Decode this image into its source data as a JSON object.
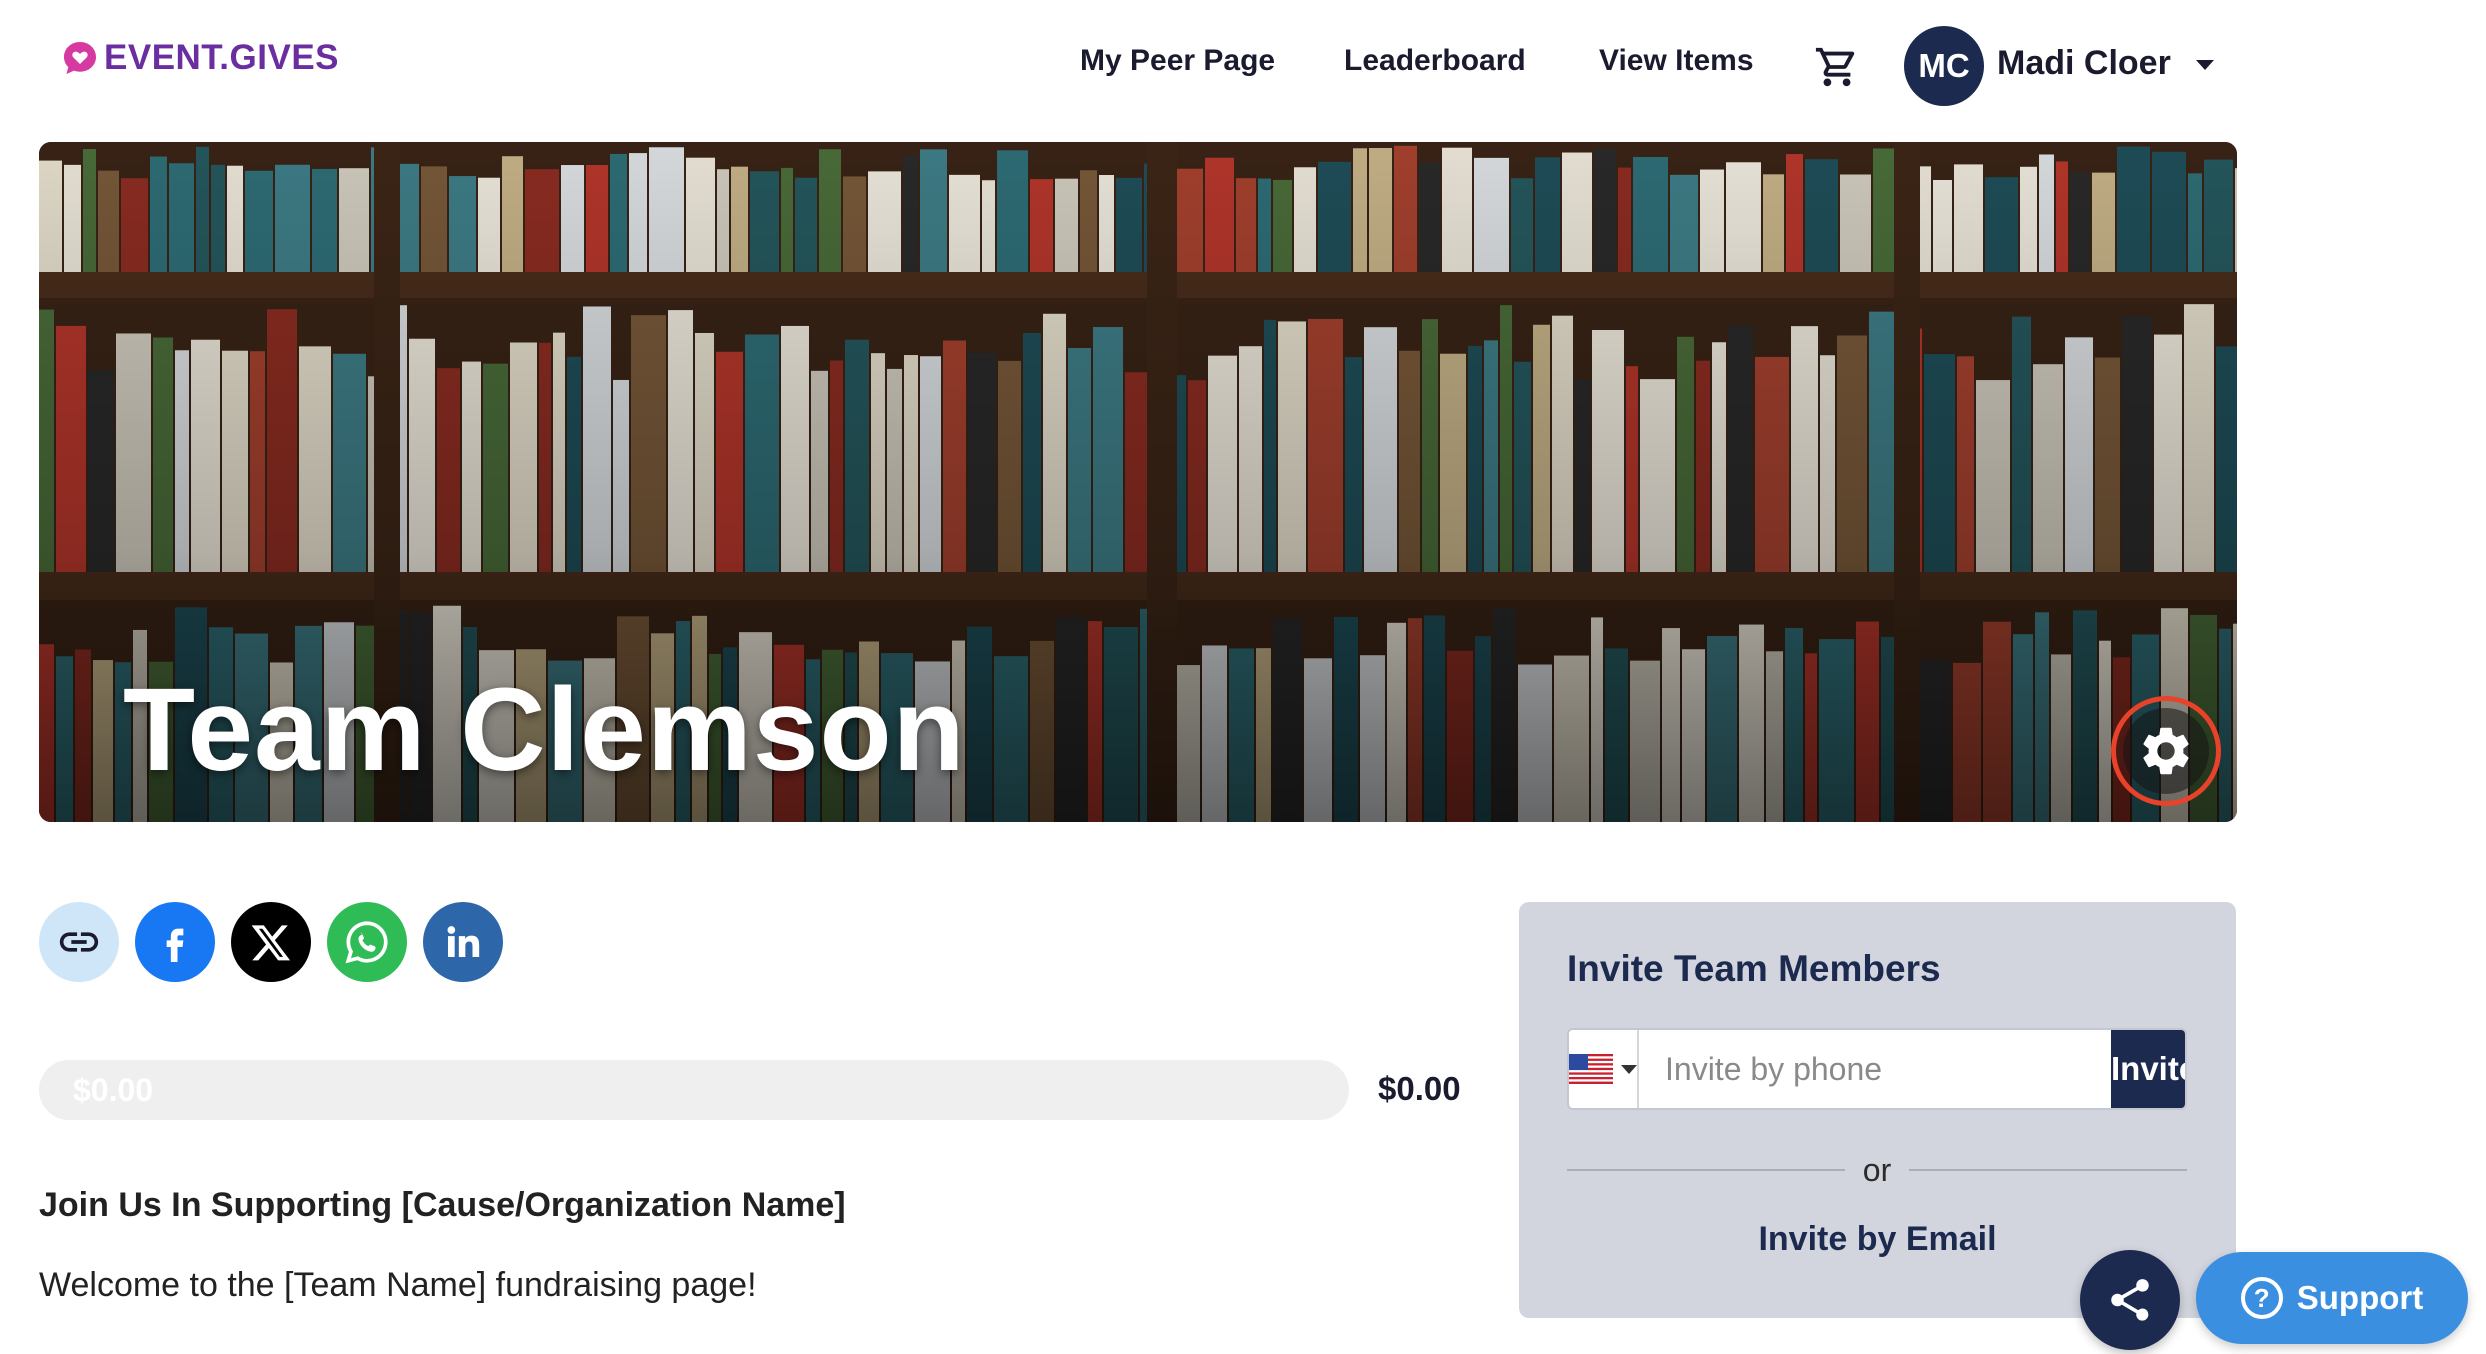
{
  "header": {
    "logo_text": "EVENT.GIVES",
    "nav": [
      "My Peer Page",
      "Leaderboard",
      "View Items"
    ],
    "cart_icon": "shopping-cart-icon",
    "user": {
      "initials": "MC",
      "name": "Madi Cloer"
    }
  },
  "hero": {
    "title": "Team Clemson",
    "settings_icon": "gear-icon"
  },
  "share": {
    "icons": [
      "link-icon",
      "facebook-icon",
      "x-icon",
      "whatsapp-icon",
      "linkedin-icon"
    ],
    "colors": {
      "link": "#cfe6f9",
      "facebook": "#1877f2",
      "x": "#000000",
      "whatsapp": "#2fbb55",
      "linkedin": "#2d66a9"
    }
  },
  "progress": {
    "raised_label": "$0.00",
    "total_label": "$0.00",
    "fraction": 0
  },
  "content": {
    "heading": "Join Us In Supporting [Cause/Organization Name]",
    "text": "Welcome to the [Team Name] fundraising page!"
  },
  "invite": {
    "title": "Invite Team Members",
    "country": "US",
    "phone_placeholder": "Invite by phone",
    "invite_button": "Invite",
    "or_text": "or",
    "email_link": "Invite by Email"
  },
  "floating": {
    "share_icon": "share-icon",
    "support_label": "Support"
  },
  "colors": {
    "brand_purple": "#6a2ea0",
    "navy": "#1c2a4f",
    "highlight_red": "#e8432a",
    "support_blue": "#3a8fe0"
  }
}
